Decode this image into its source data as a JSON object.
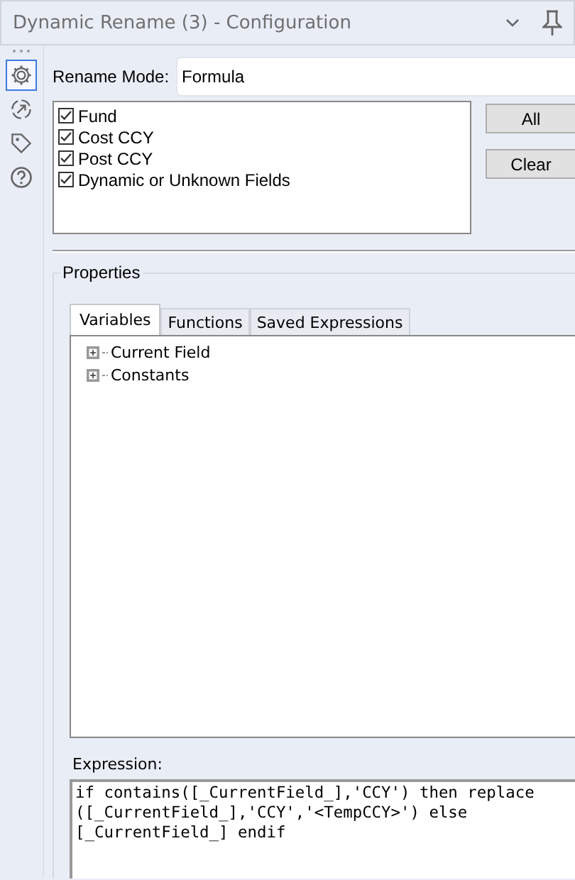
{
  "window": {
    "title": "Dynamic Rename (3) - Configuration"
  },
  "sidebar": {
    "items": [
      {
        "kind": "gear",
        "selected": true
      },
      {
        "kind": "arrow",
        "selected": false
      },
      {
        "kind": "tag",
        "selected": false
      },
      {
        "kind": "help",
        "selected": false
      }
    ]
  },
  "rename_mode": {
    "label": "Rename Mode:",
    "value": "Formula"
  },
  "fields": [
    {
      "label": "Fund",
      "checked": true
    },
    {
      "label": "Cost CCY",
      "checked": true
    },
    {
      "label": "Post CCY",
      "checked": true
    },
    {
      "label": "Dynamic or Unknown Fields",
      "checked": true
    }
  ],
  "buttons": [
    "All",
    "Clear"
  ],
  "properties": {
    "title": "Properties",
    "tabs": [
      {
        "label": "Variables",
        "selected": true
      },
      {
        "label": "Functions",
        "selected": false
      },
      {
        "label": "Saved Expressions",
        "selected": false
      }
    ],
    "tree": [
      {
        "label": "Current Field",
        "expanded": false
      },
      {
        "label": "Constants",
        "expanded": false
      }
    ],
    "expression": {
      "label": "Expression:",
      "lines": [
        "if contains([_CurrentField_],'CCY') then replace",
        "([_CurrentField_],'CCY','<TempCCY>') else",
        "[_CurrentField_] endif"
      ]
    }
  }
}
